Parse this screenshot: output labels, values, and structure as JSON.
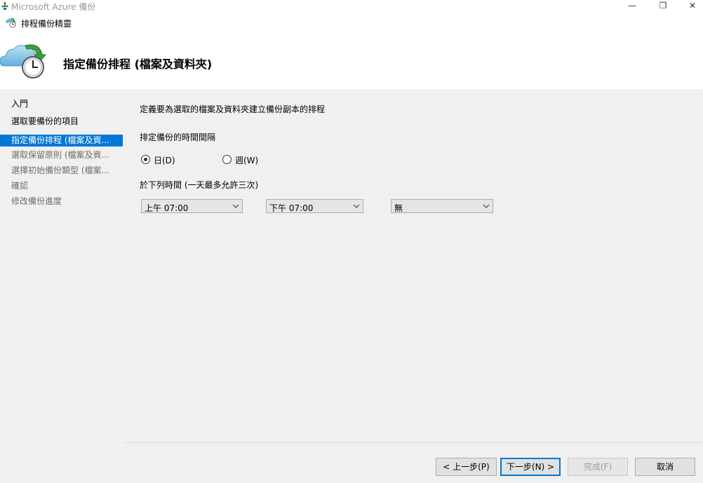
{
  "window": {
    "title": "Microsoft Azure 備份",
    "minimize_glyph": "—",
    "maximize_glyph": "❐",
    "close_glyph": "✕"
  },
  "wizard": {
    "title": "排程備份精靈"
  },
  "banner": {
    "page_title": "指定備份排程 (檔案及資料夾)",
    "icon": "cloud-clock-icon"
  },
  "nav": {
    "items": [
      {
        "label": "入門",
        "state": "done"
      },
      {
        "label": "選取要備份的項目",
        "state": "done"
      },
      {
        "label": "指定備份排程 (檔案及資...",
        "state": "selected"
      },
      {
        "label": "選取保留原則 (檔案及資...",
        "state": "pending"
      },
      {
        "label": "選擇初始備份類型 (檔案...",
        "state": "pending"
      },
      {
        "label": "確認",
        "state": "pending"
      },
      {
        "label": "修改備份進度",
        "state": "pending"
      }
    ]
  },
  "main": {
    "description": "定義要為選取的檔案及資料夾建立備份副本的排程",
    "interval_label": "排定備份的時間間隔",
    "radio_day": {
      "label": "日(D)",
      "checked": true
    },
    "radio_week": {
      "label": "週(W)",
      "checked": false
    },
    "times_label": "於下列時間 (一天最多允許三次)",
    "time_selects": [
      "上午 07:00",
      "下午 07:00",
      "無"
    ]
  },
  "footer": {
    "prev": "< 上一步(P)",
    "next": "下一步(N) >",
    "finish": "完成(F)",
    "cancel": "取消"
  },
  "colors": {
    "selected_bg": "#0078d7",
    "panel_bg": "#f0f0f0"
  }
}
